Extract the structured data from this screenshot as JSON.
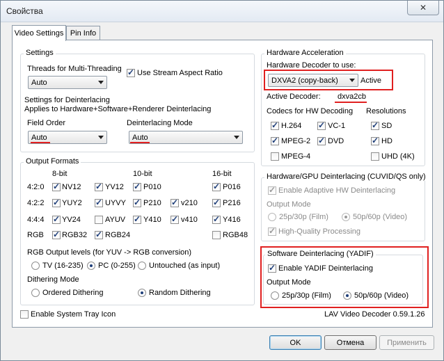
{
  "window": {
    "title": "Свойства",
    "close_glyph": "✕"
  },
  "tabs": [
    {
      "label": "Video Settings"
    },
    {
      "label": "Pin Info"
    }
  ],
  "settings": {
    "group_title": "Settings",
    "threads_label": "Threads for Multi-Threading",
    "threads_value": "Auto",
    "use_stream_aspect_label": "Use Stream Aspect Ratio",
    "deint_line1": "Settings for Deinterlacing",
    "deint_line2": "Applies to Hardware+Software+Renderer Deinterlacing",
    "field_order_label": "Field Order",
    "field_order_value": "Auto",
    "deint_mode_label": "Deinterlacing Mode",
    "deint_mode_value": "Auto"
  },
  "output_formats": {
    "group_title": "Output Formats",
    "headers": {
      "bit8": "8-bit",
      "bit10": "10-bit",
      "bit16": "16-bit"
    },
    "rows": [
      {
        "label": "4:2:0",
        "items": [
          "NV12",
          "YV12",
          "P010",
          "P016"
        ]
      },
      {
        "label": "4:2:2",
        "items": [
          "YUY2",
          "UYVY",
          "P210",
          "v210",
          "P216"
        ]
      },
      {
        "label": "4:4:4",
        "items": [
          "YV24",
          "AYUV",
          "Y410",
          "v410",
          "Y416"
        ]
      },
      {
        "label": "RGB",
        "items": [
          "RGB32",
          "RGB24",
          "RGB48"
        ]
      }
    ],
    "rgb_levels_title": "RGB Output levels (for YUV -> RGB conversion)",
    "rgb_levels": [
      "TV (16-235)",
      "PC (0-255)",
      "Untouched (as input)"
    ],
    "dithering_title": "Dithering Mode",
    "dithering": [
      "Ordered Dithering",
      "Random Dithering"
    ]
  },
  "hw_accel": {
    "group_title": "Hardware Acceleration",
    "decoder_label": "Hardware Decoder to use:",
    "decoder_value": "DXVA2 (copy-back)",
    "decoder_status": "Active",
    "active_decoder_label": "Active Decoder:",
    "active_decoder_value": "dxva2cb",
    "codecs_title": "Codecs for HW Decoding",
    "resolutions_title": "Resolutions",
    "codecs": [
      "H.264",
      "VC-1",
      "MPEG-2",
      "DVD",
      "MPEG-4"
    ],
    "resolutions": [
      "SD",
      "HD",
      "UHD (4K)"
    ]
  },
  "hw_deint": {
    "group_title": "Hardware/GPU Deinterlacing (CUVID/QS only)",
    "enable_label": "Enable Adaptive HW Deinterlacing",
    "output_mode_label": "Output Mode",
    "mode_film": "25p/30p (Film)",
    "mode_video": "50p/60p (Video)",
    "hq_label": "High-Quality Processing"
  },
  "sw_deint": {
    "group_title": "Software Deinterlacing (YADIF)",
    "enable_label": "Enable YADIF Deinterlacing",
    "output_mode_label": "Output Mode",
    "mode_film": "25p/30p (Film)",
    "mode_video": "50p/60p (Video)"
  },
  "footer": {
    "tray_label": "Enable System Tray Icon",
    "version": "LAV Video Decoder 0.59.1.26"
  },
  "buttons": {
    "ok": "OK",
    "cancel": "Отмена",
    "apply": "Применить"
  },
  "colors": {
    "highlight": "#e02020",
    "check": "#1f3f7a"
  }
}
